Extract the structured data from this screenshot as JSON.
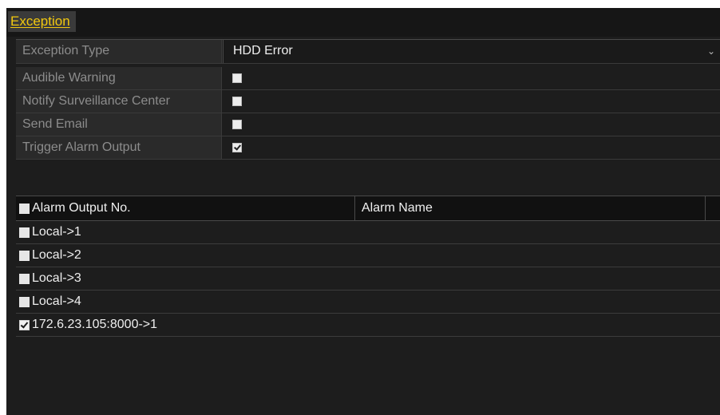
{
  "tabs": [
    {
      "label": "Exception",
      "active": true
    }
  ],
  "form": {
    "exception_type": {
      "label": "Exception Type",
      "value": "HDD Error"
    },
    "audible_warning": {
      "label": "Audible Warning",
      "checked": false
    },
    "notify_surveillance_center": {
      "label": "Notify Surveillance Center",
      "checked": false
    },
    "send_email": {
      "label": "Send Email",
      "checked": false
    },
    "trigger_alarm_output": {
      "label": "Trigger Alarm Output",
      "checked": true
    }
  },
  "alarm_table": {
    "columns": [
      "Alarm Output No.",
      "Alarm Name"
    ],
    "select_all_checked": false,
    "rows": [
      {
        "output_no": "Local->1",
        "name": "",
        "checked": false
      },
      {
        "output_no": "Local->2",
        "name": "",
        "checked": false
      },
      {
        "output_no": "Local->3",
        "name": "",
        "checked": false
      },
      {
        "output_no": "Local->4",
        "name": "",
        "checked": false
      },
      {
        "output_no": "172.6.23.105:8000->1",
        "name": "",
        "checked": true
      }
    ]
  },
  "colors": {
    "accent": "#f2c80f",
    "background": "#1d1d1d",
    "label_text": "#8c8c8c",
    "value_text": "#eeeeee"
  }
}
